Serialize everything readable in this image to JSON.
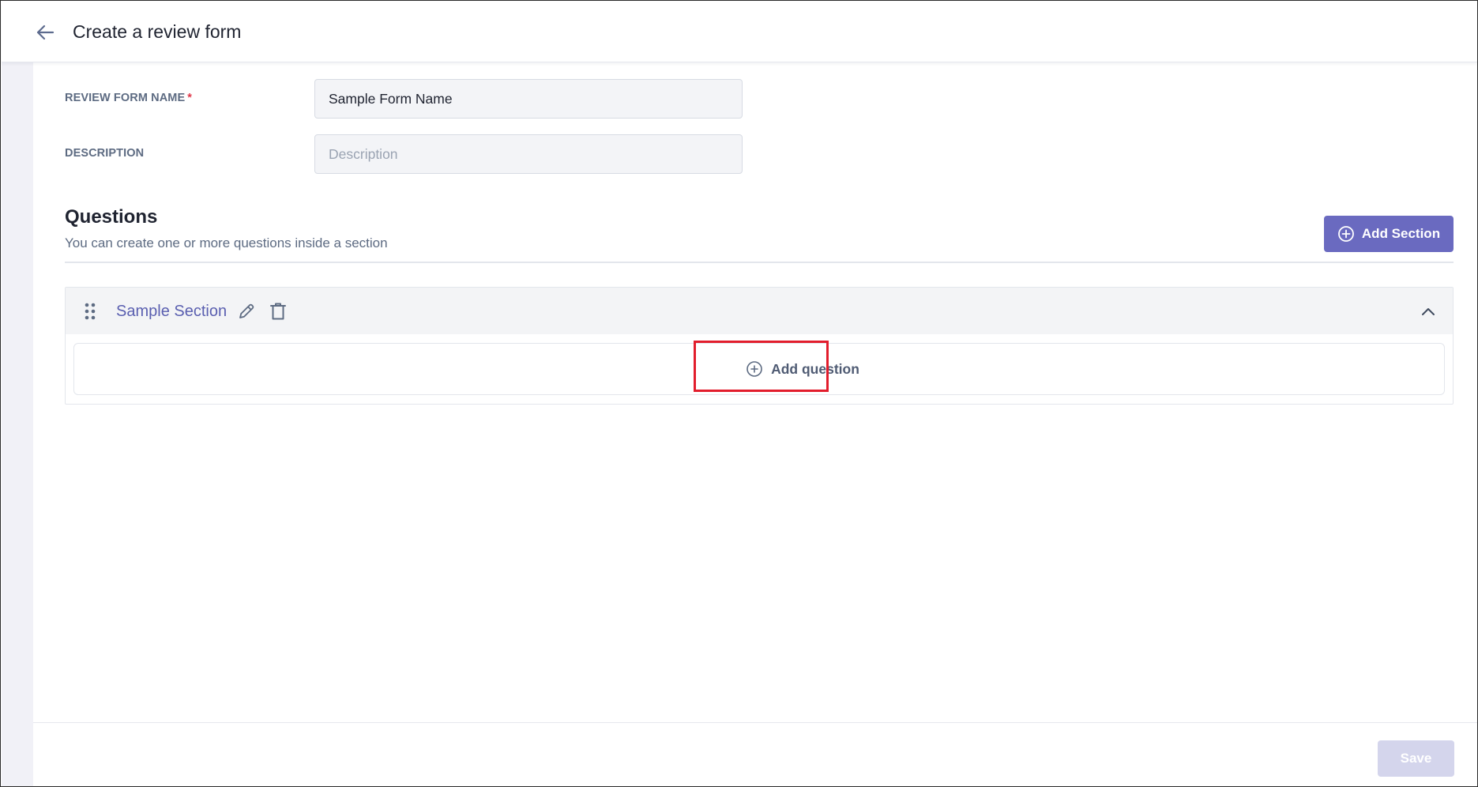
{
  "header": {
    "title": "Create a review form",
    "back_icon": "arrow-left-icon"
  },
  "form": {
    "name_label": "REVIEW FORM NAME",
    "name_required_mark": "*",
    "name_value": "Sample Form Name",
    "description_label": "DESCRIPTION",
    "description_placeholder": "Description",
    "description_value": ""
  },
  "questions": {
    "title": "Questions",
    "subtitle": "You can create one or more questions inside a section",
    "add_section_label": "Add Section",
    "add_section_icon": "plus-circle-icon"
  },
  "section": {
    "name": "Sample Section",
    "drag_icon": "drag-handle-icon",
    "edit_icon": "pencil-icon",
    "delete_icon": "trash-icon",
    "collapse_icon": "chevron-up-icon",
    "add_question_label": "Add question",
    "add_question_icon": "plus-circle-icon"
  },
  "footer": {
    "save_label": "Save"
  },
  "colors": {
    "accent": "#6a6ac0",
    "section_title": "#5a5fb0",
    "save_disabled": "#d4d5ec",
    "highlight": "#e21d2c",
    "label": "#5d6b82",
    "required": "#e0384a"
  }
}
